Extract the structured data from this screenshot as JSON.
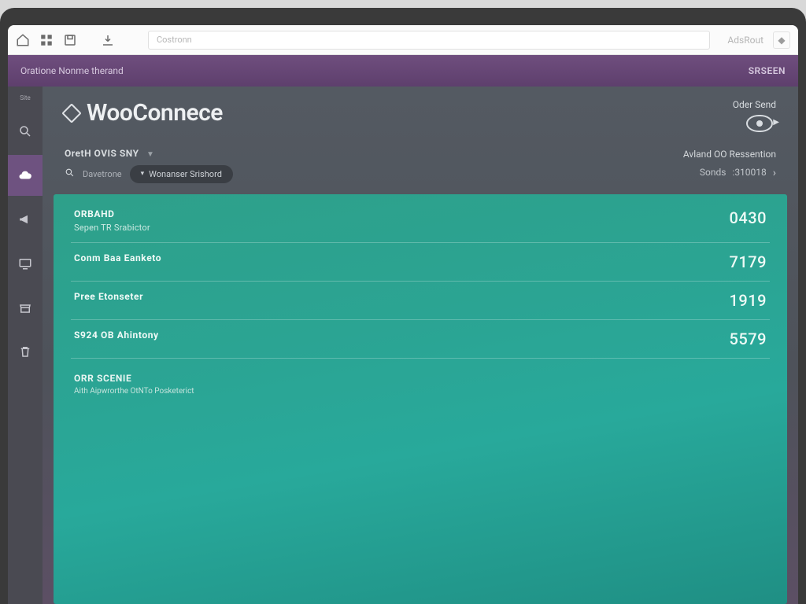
{
  "toolbar": {
    "address_placeholder": "Costronn",
    "right_label": "AdsRout",
    "icons": [
      "home-icon",
      "grid-icon",
      "disk-icon",
      "download-icon"
    ]
  },
  "purple_bar": {
    "left": "Oratione Nonme therand",
    "right": "SRSEEN"
  },
  "brand": {
    "name": "WooConnece"
  },
  "corner": {
    "label": "Oder Send"
  },
  "subhead": {
    "site_label": "Site",
    "overview_tab": "OretH OVIS SNY",
    "search_label": "Davetrone",
    "dropdown_label": "Wonanser Srishord"
  },
  "right_meta": {
    "line1": "Avland OO Ressention",
    "sonds_label": "Sonds",
    "sonds_value": ":310018"
  },
  "panel": {
    "rows": [
      {
        "title": "ORBAHD",
        "sub": "Sepen TR Srabictor",
        "value": "0430"
      },
      {
        "title": "Conm Baa Eanketo",
        "sub": "",
        "value": "7179"
      },
      {
        "title": "Pree Etonseter",
        "sub": "",
        "value": "1919"
      },
      {
        "title": "S924 OB Ahintony",
        "sub": "",
        "value": "5579"
      }
    ],
    "section2": {
      "header": "ORR SCENIE",
      "sub": "Aith Aipwrorthe OtNTo Posketerict"
    }
  },
  "sidebar": {
    "label": "Site",
    "items": [
      {
        "name": "search",
        "active": false
      },
      {
        "name": "cloud",
        "active": true
      },
      {
        "name": "megaphone",
        "active": false
      },
      {
        "name": "screen",
        "active": false
      },
      {
        "name": "store",
        "active": false
      },
      {
        "name": "trash",
        "active": false
      }
    ]
  }
}
